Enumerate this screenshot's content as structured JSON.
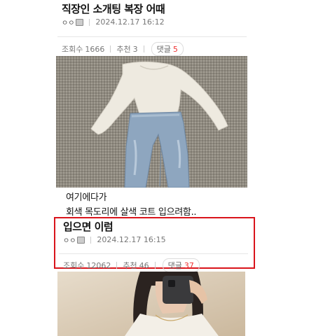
{
  "post1": {
    "title": "직장인 소개팅 복장 어때",
    "author": "ㅇㅇ",
    "date": "2024.12.17 16:12",
    "views_label": "조회수",
    "views": "1666",
    "likes_label": "추천",
    "likes": "3",
    "comments_label": "댓글",
    "comments": "5"
  },
  "photo1": {
    "caption_icon": "outfit-photo"
  },
  "text_lines": [
    "여기에다가",
    "회색 목도리에 살색 코트 입으려함.."
  ],
  "post2": {
    "title": "입으면 이럼",
    "author": "ㅇㅇ",
    "date": "2024.12.17 16:15",
    "views_label": "조회수",
    "views": "12062",
    "likes_label": "추천",
    "likes": "46",
    "comments_label": "댓글",
    "comments": "37"
  },
  "colors": {
    "highlight": "#d9141b",
    "comment_count": "#e33333"
  }
}
